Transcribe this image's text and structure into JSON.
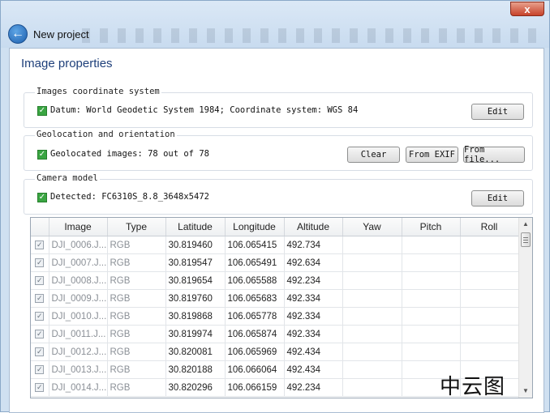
{
  "window": {
    "title": "New project",
    "close_label": "x"
  },
  "page": {
    "title": "Image properties"
  },
  "coordinate_system": {
    "group_title": "Images coordinate system",
    "text": "Datum: World Geodetic System 1984; Coordinate system: WGS 84",
    "edit_label": "Edit"
  },
  "geolocation": {
    "group_title": "Geolocation and orientation",
    "text": "Geolocated images: 78 out of 78",
    "clear_label": "Clear",
    "from_exif_label": "From EXIF",
    "from_file_label": "From file..."
  },
  "camera": {
    "group_title": "Camera model",
    "text": "Detected: FC6310S_8.8_3648x5472",
    "edit_label": "Edit"
  },
  "table": {
    "columns": [
      "",
      "Image",
      "Type",
      "Latitude",
      "Longitude",
      "Altitude",
      "Yaw",
      "Pitch",
      "Roll"
    ],
    "rows": [
      {
        "image": "DJI_0006.J...",
        "type": "RGB",
        "lat": "30.819460",
        "lon": "106.065415",
        "alt": "492.734",
        "yaw": "",
        "pitch": "",
        "roll": ""
      },
      {
        "image": "DJI_0007.J...",
        "type": "RGB",
        "lat": "30.819547",
        "lon": "106.065491",
        "alt": "492.634",
        "yaw": "",
        "pitch": "",
        "roll": ""
      },
      {
        "image": "DJI_0008.J...",
        "type": "RGB",
        "lat": "30.819654",
        "lon": "106.065588",
        "alt": "492.234",
        "yaw": "",
        "pitch": "",
        "roll": ""
      },
      {
        "image": "DJI_0009.J...",
        "type": "RGB",
        "lat": "30.819760",
        "lon": "106.065683",
        "alt": "492.334",
        "yaw": "",
        "pitch": "",
        "roll": ""
      },
      {
        "image": "DJI_0010.J...",
        "type": "RGB",
        "lat": "30.819868",
        "lon": "106.065778",
        "alt": "492.334",
        "yaw": "",
        "pitch": "",
        "roll": ""
      },
      {
        "image": "DJI_0011.J...",
        "type": "RGB",
        "lat": "30.819974",
        "lon": "106.065874",
        "alt": "492.334",
        "yaw": "",
        "pitch": "",
        "roll": ""
      },
      {
        "image": "DJI_0012.J...",
        "type": "RGB",
        "lat": "30.820081",
        "lon": "106.065969",
        "alt": "492.434",
        "yaw": "",
        "pitch": "",
        "roll": ""
      },
      {
        "image": "DJI_0013.J...",
        "type": "RGB",
        "lat": "30.820188",
        "lon": "106.066064",
        "alt": "492.434",
        "yaw": "",
        "pitch": "",
        "roll": ""
      },
      {
        "image": "DJI_0014.J...",
        "type": "RGB",
        "lat": "30.820296",
        "lon": "106.066159",
        "alt": "492.234",
        "yaw": "",
        "pitch": "",
        "roll": ""
      }
    ]
  },
  "watermark": {
    "text": "中云图"
  },
  "colors": {
    "accent": "#1e3f7a",
    "check": "#3aa542",
    "close": "#c7432b"
  }
}
